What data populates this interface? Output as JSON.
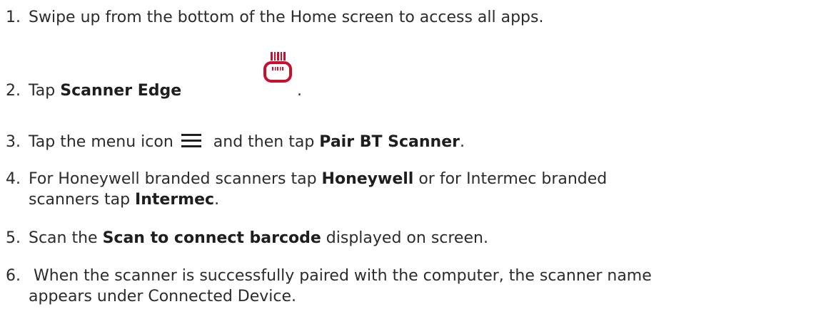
{
  "steps": [
    {
      "num": "1.",
      "text": "Swipe up from the bottom of the Home screen to access all apps."
    },
    {
      "num": "2.",
      "pre": "Tap ",
      "bold": "Scanner Edge",
      "post": ".",
      "icon": "scanner-edge-app-icon"
    },
    {
      "num": "3.",
      "pre": "Tap the menu icon ",
      "icon": "hamburger-menu-icon",
      "mid": " and then tap ",
      "bold": "Pair BT Scanner",
      "post": "."
    },
    {
      "num": "4.",
      "pre": "For Honeywell branded scanners tap ",
      "bold": "Honeywell",
      "mid": " or for Intermec branded",
      "line2_pre": "scanners tap ",
      "line2_bold": "Intermec",
      "line2_post": "."
    },
    {
      "num": "5.",
      "pre": "Scan the ",
      "bold": "Scan to connect barcode",
      "post": " displayed on screen."
    },
    {
      "num": "6.",
      "pre": " When the scanner is successfully paired with the computer, the scanner name",
      "line2_pre": "appears under Connected Device."
    }
  ],
  "colors": {
    "accent": "#c8102e",
    "text": "#2b2b2b"
  }
}
